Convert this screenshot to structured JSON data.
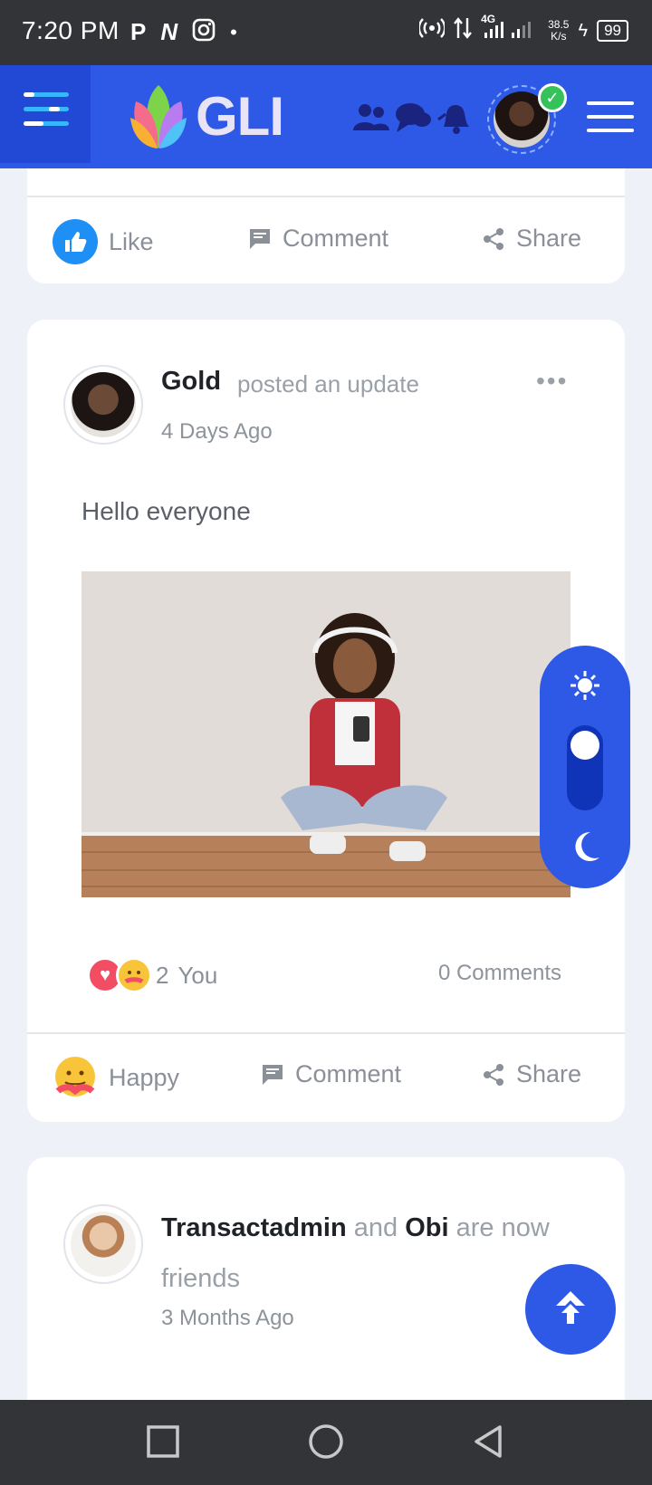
{
  "status_bar": {
    "time": "7:20 PM",
    "left_glyphs": [
      "P",
      "N"
    ],
    "network": "4G",
    "speed_value": "38.5",
    "speed_unit": "K/s",
    "battery": "99"
  },
  "header": {
    "logo_text": "GLI"
  },
  "prev_post_actions": {
    "like": "Like",
    "comment": "Comment",
    "share": "Share"
  },
  "post": {
    "author": "Gold",
    "action": "posted an update",
    "time": "4 Days Ago",
    "menu": "•••",
    "text": "Hello everyone",
    "reaction_count": "2",
    "reaction_you": "You",
    "comments": "0 Comments",
    "actions": {
      "happy": "Happy",
      "comment": "Comment",
      "share": "Share"
    }
  },
  "friend_update": {
    "user1": "Transactadmin",
    "conjunction": "and",
    "user2": "Obi",
    "phrase": "are now friends",
    "time": "3 Months Ago"
  },
  "colors": {
    "brand": "#2e59e6",
    "like": "#1e8ff4",
    "heart": "#f34d63"
  }
}
